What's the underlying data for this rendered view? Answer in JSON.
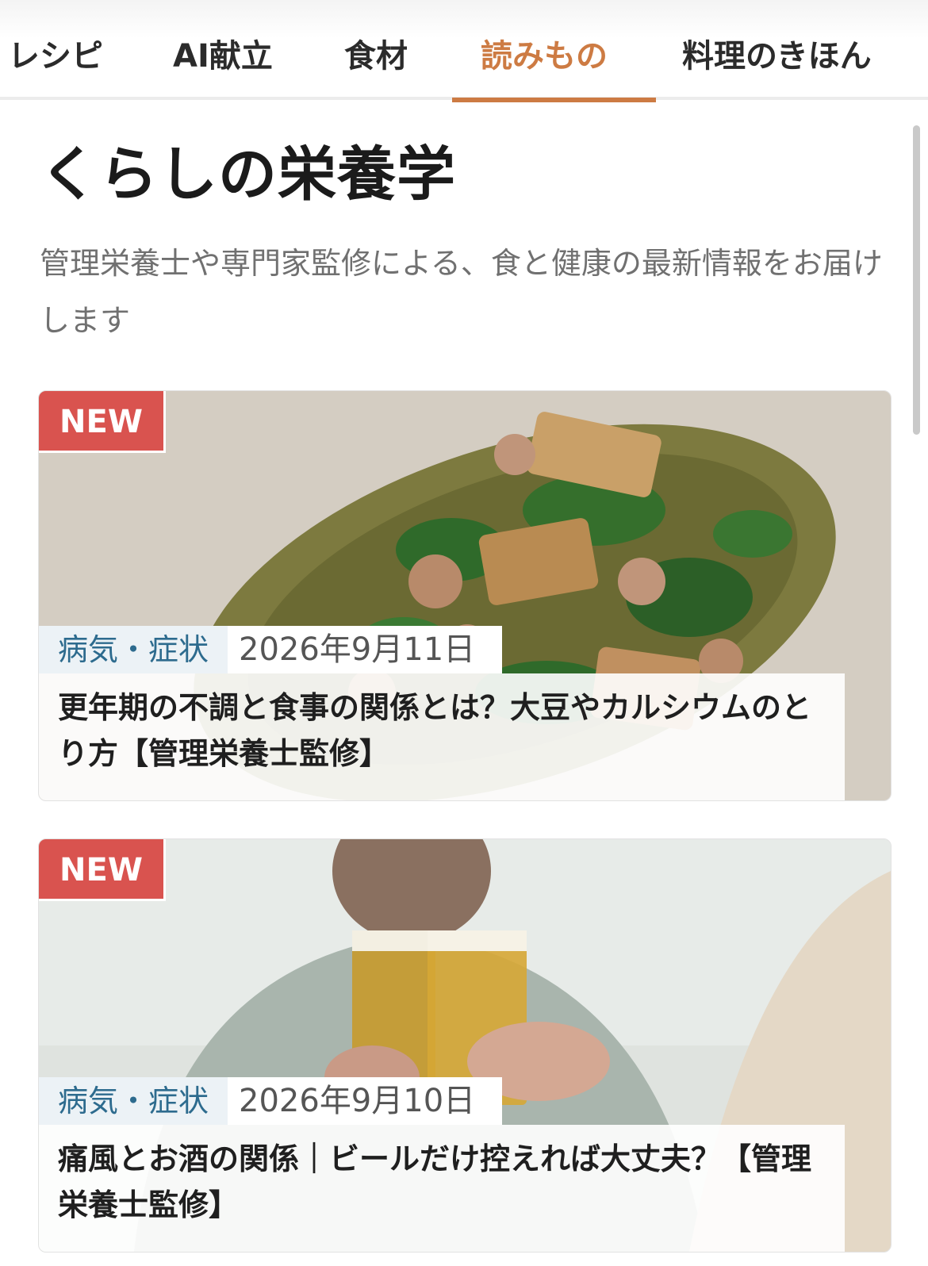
{
  "nav": {
    "tabs": [
      {
        "label": "レシピ"
      },
      {
        "label": "AI献立"
      },
      {
        "label": "食材"
      },
      {
        "label": "読みもの",
        "active": true
      },
      {
        "label": "料理のきほん"
      }
    ]
  },
  "page": {
    "title": "くらしの栄養学",
    "description": "管理栄養士や専門家監修による、食と健康の最新情報をお届けします"
  },
  "articles": [
    {
      "badge": "NEW",
      "category": "病気・症状",
      "date": "2026年9月11日",
      "title": "更年期の不調と食事の関係とは？大豆やカルシウムのとり方【管理栄養士監修】"
    },
    {
      "badge": "NEW",
      "category": "病気・症状",
      "date": "2026年9月10日",
      "title": "痛風とお酒の関係｜ビールだけ控えれば大丈夫？【管理栄養士監修】"
    }
  ],
  "colors": {
    "accent": "#cd7b43",
    "badge": "#d9534f",
    "category_text": "#2d6b8e"
  }
}
